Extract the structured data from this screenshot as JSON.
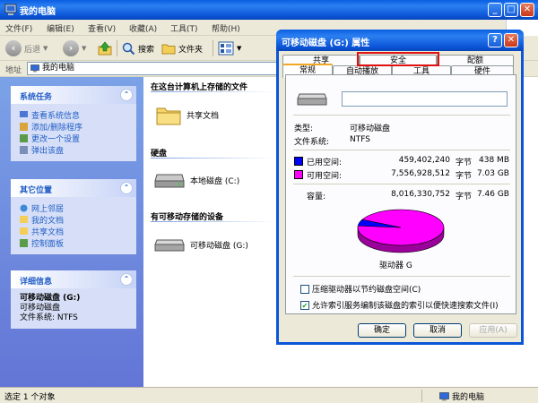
{
  "explorer": {
    "title": "我的电脑",
    "menu": [
      "文件(F)",
      "编辑(E)",
      "查看(V)",
      "收藏(A)",
      "工具(T)",
      "帮助(H)"
    ],
    "toolbar": {
      "back": "后退",
      "search": "搜索",
      "folders": "文件夹"
    },
    "address": {
      "label": "地址",
      "value": "我的电脑"
    },
    "tasks": {
      "system": {
        "title": "系统任务",
        "items": [
          "查看系统信息",
          "添加/删除程序",
          "更改一个设置",
          "弹出该盘"
        ]
      },
      "other": {
        "title": "其它位置",
        "items": [
          "网上邻居",
          "我的文档",
          "共享文档",
          "控制面板"
        ]
      },
      "details": {
        "title": "详细信息",
        "name": "可移动磁盘 (G:)",
        "type": "可移动磁盘",
        "fs_label": "文件系统:",
        "fs_value": "NTFS"
      }
    },
    "groups": {
      "stored": {
        "header": "在这台计算机上存储的文件",
        "item": "共享文档"
      },
      "hdd": {
        "header": "硬盘",
        "item": "本地磁盘 (C:)"
      },
      "removable": {
        "header": "有可移动存储的设备",
        "item": "可移动磁盘 (G:)"
      }
    },
    "status": {
      "left": "选定 1 个对象",
      "right": "我的电脑"
    }
  },
  "dialog": {
    "title": "可移动磁盘 (G:) 属性",
    "tabs_back": [
      "共享",
      "安全",
      "配额"
    ],
    "tabs_front": [
      "常规",
      "自动播放",
      "工具",
      "硬件"
    ],
    "type_label": "类型:",
    "type_value": "可移动磁盘",
    "fs_label": "文件系统:",
    "fs_value": "NTFS",
    "used": {
      "label": "已用空间:",
      "bytes": "459,402,240",
      "unit": "字节",
      "size": "438 MB",
      "color": "#0000ff"
    },
    "free": {
      "label": "可用空间:",
      "bytes": "7,556,928,512",
      "unit": "字节",
      "size": "7.03 GB",
      "color": "#ff00ff"
    },
    "capacity": {
      "label": "容量:",
      "bytes": "8,016,330,752",
      "unit": "字节",
      "size": "7.46 GB"
    },
    "drive_label": "驱动器 G",
    "used_fraction": 0.0573,
    "checkbox_compress": "压缩驱动器以节约磁盘空间(C)",
    "checkbox_index": "允许索引服务编制该磁盘的索引以便快速搜索文件(I)",
    "buttons": {
      "ok": "确定",
      "cancel": "取消",
      "apply": "应用(A)"
    }
  }
}
